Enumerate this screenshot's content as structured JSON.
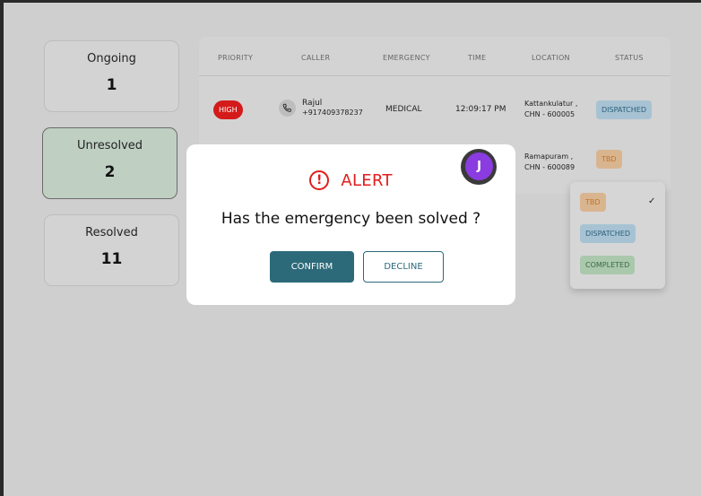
{
  "stats": [
    {
      "label": "Ongoing",
      "value": "1"
    },
    {
      "label": "Unresolved",
      "value": "2"
    },
    {
      "label": "Resolved",
      "value": "11"
    }
  ],
  "table": {
    "headers": [
      "PRIORITY",
      "CALLER",
      "EMERGENCY",
      "TIME",
      "LOCATION",
      "STATUS"
    ],
    "rows": [
      {
        "priority": "HIGH",
        "caller_name": "Rajul",
        "caller_phone": "+917409378237",
        "emergency": "MEDICAL",
        "time": "12:09:17 PM",
        "location_line1": "Kattankulatur ,",
        "location_line2": "CHN - 600005",
        "status": "DISPATCHED"
      },
      {
        "location_line1": "Ramapuram ,",
        "location_line2": "CHN - 600089",
        "status": "TBD"
      }
    ]
  },
  "status_dropdown": {
    "options": [
      "TBD",
      "DISPATCHED",
      "COMPLETED"
    ],
    "selected": "TBD",
    "check_mark": "✓"
  },
  "alert_modal": {
    "title": "ALERT",
    "icon_glyph": "!",
    "question": "Has the emergency been solved ?",
    "confirm_label": "CONFIRM",
    "decline_label": "DECLINE"
  },
  "avatar": {
    "initial": "J",
    "color": "#8a3ce0"
  },
  "colors": {
    "accent": "#2c6a7a",
    "alert": "#e11d1d",
    "high_priority": "#d41a1a"
  }
}
